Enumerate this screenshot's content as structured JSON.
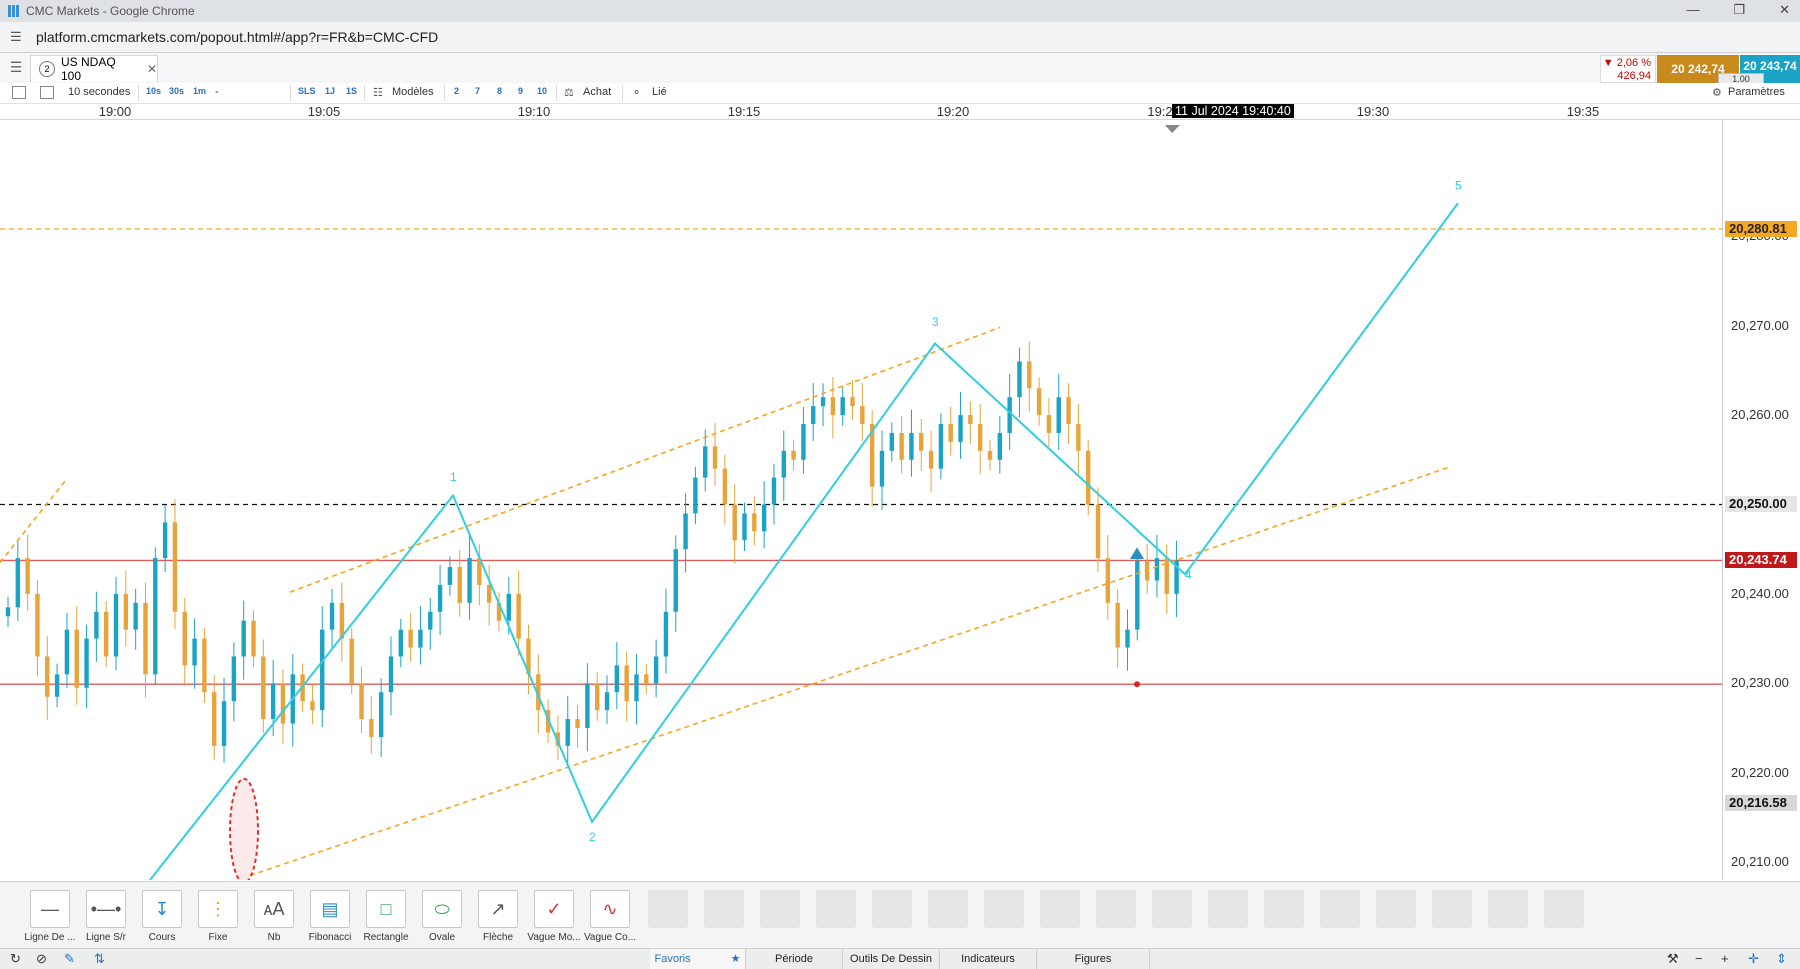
{
  "browser": {
    "window_title": "CMC Markets - Google Chrome",
    "url": "platform.cmcmarkets.com/popout.html#/app?r=FR&b=CMC-CFD"
  },
  "instrument": {
    "tab_number": "2",
    "name": "US NDAQ 100",
    "change_pct": "▼ 2,06 %",
    "change_pts": "426,94",
    "sell_price": "20 242,74",
    "buy_price": "20 243,74",
    "spread": "1.00"
  },
  "toolbar": {
    "interval": "10 secondes",
    "interval_buttons": [
      "10s",
      "30s",
      "1m",
      "-"
    ],
    "order_buttons": [
      "SLS",
      "1J",
      "1S"
    ],
    "templates_label": "Modèles",
    "count_buttons": [
      "2",
      "7",
      "8",
      "9",
      "10"
    ],
    "buy_label": "Achat",
    "linked_label": "Lié",
    "settings_label": "Paramètres"
  },
  "time_axis": {
    "ticks": [
      "19:00",
      "19:05",
      "19:10",
      "19:15",
      "19:20",
      "19:2",
      "19:30",
      "19:35"
    ],
    "crosshair_label": "11 Jul 2024 19:40:40"
  },
  "chart_data": {
    "type": "candlestick",
    "interval": "10 secondes",
    "x_range": [
      "18:58:20",
      "19:39:30"
    ],
    "ylim": [
      20208,
      20293
    ],
    "y_ticks": [
      "20,210.00",
      "20,220.00",
      "20,230.00",
      "20,240.00",
      "20,250.00",
      "20,260.00",
      "20,270.00",
      "20,280.00"
    ],
    "tick_values": [
      20210,
      20220,
      20230,
      20240,
      20250,
      20260,
      20270,
      20280
    ],
    "price_tags": [
      {
        "label": "20,280.81",
        "value": 20280.81,
        "color": "#f5a623",
        "text_color": "#222"
      },
      {
        "label": "20,250.00",
        "value": 20250.0,
        "color": "#e6e6e6",
        "text_color": "#111"
      },
      {
        "label": "20,243.74",
        "value": 20243.74,
        "color": "#c0191c",
        "text_color": "#fff"
      },
      {
        "label": "20,216.58",
        "value": 20216.58,
        "color": "#d7d7d7",
        "text_color": "#111"
      }
    ],
    "horizontal_lines": [
      {
        "value": 20280.81,
        "style": "dashed",
        "color": "#f5a623"
      },
      {
        "value": 20250.0,
        "style": "dashed",
        "color": "#111"
      },
      {
        "value": 20243.74,
        "style": "solid",
        "color": "#e05a5a"
      },
      {
        "value": 20229.9,
        "style": "solid",
        "color": "#e05a5a"
      }
    ],
    "bull_color": "#1ba3c6",
    "bear_color": "#e8a33a",
    "closes": [
      20238.5,
      20244,
      20240,
      20233,
      20228.5,
      20231,
      20236,
      20229.5,
      20235,
      20238,
      20233,
      20240,
      20236,
      20239,
      20231,
      20244,
      20248,
      20238,
      20232,
      20235,
      20229,
      20223,
      20228,
      20233,
      20237,
      20233,
      20226,
      20230,
      20225.5,
      20231,
      20228,
      20227,
      20236,
      20239,
      20235,
      20230,
      20226,
      20224,
      20229,
      20233,
      20236,
      20234,
      20236,
      20238,
      20241,
      20243,
      20239,
      20244,
      20241,
      20239,
      20237,
      20240,
      20235,
      20231,
      20227,
      20224.5,
      20223,
      20226,
      20225,
      20230,
      20227,
      20229,
      20232,
      20228,
      20231,
      20230,
      20233,
      20238,
      20245,
      20249,
      20253,
      20256.5,
      20254,
      20250,
      20246,
      20249,
      20247,
      20250,
      20253,
      20256,
      20255,
      20259,
      20261,
      20262,
      20260,
      20262,
      20261,
      20259,
      20252,
      20256,
      20258,
      20255,
      20258,
      20256,
      20254,
      20259,
      20257,
      20260,
      20259,
      20256,
      20255,
      20258,
      20262,
      20266,
      20263,
      20260,
      20258,
      20262,
      20259,
      20256,
      20250,
      20244,
      20239,
      20234,
      20236,
      20243.7,
      20241.5,
      20244,
      20240,
      20243.7
    ],
    "annotations": {
      "wave_labels": [
        "1",
        "2",
        "3",
        "4",
        "5"
      ],
      "channel_color": "#f5a623",
      "wave_color": "#2ecfe0"
    }
  },
  "drawing_tools": [
    {
      "label": "Ligne De ...",
      "icon": "line-icon"
    },
    {
      "label": "Ligne S/r",
      "icon": "support-resistance-icon"
    },
    {
      "label": "Cours",
      "icon": "price-range-icon"
    },
    {
      "label": "Fixe",
      "icon": "fixed-price-icon"
    },
    {
      "label": "Nb",
      "icon": "text-note-icon"
    },
    {
      "label": "Fibonacci",
      "icon": "fibonacci-icon"
    },
    {
      "label": "Rectangle",
      "icon": "rectangle-icon"
    },
    {
      "label": "Ovale",
      "icon": "ellipse-icon"
    },
    {
      "label": "Flèche",
      "icon": "arrow-icon"
    },
    {
      "label": "Vague Mo...",
      "icon": "wave-motive-icon"
    },
    {
      "label": "Vague Co...",
      "icon": "wave-corrective-icon"
    }
  ],
  "bottom_tabs": [
    "Favoris",
    "Période",
    "Outils De Dessin",
    "Indicateurs",
    "Figures"
  ]
}
